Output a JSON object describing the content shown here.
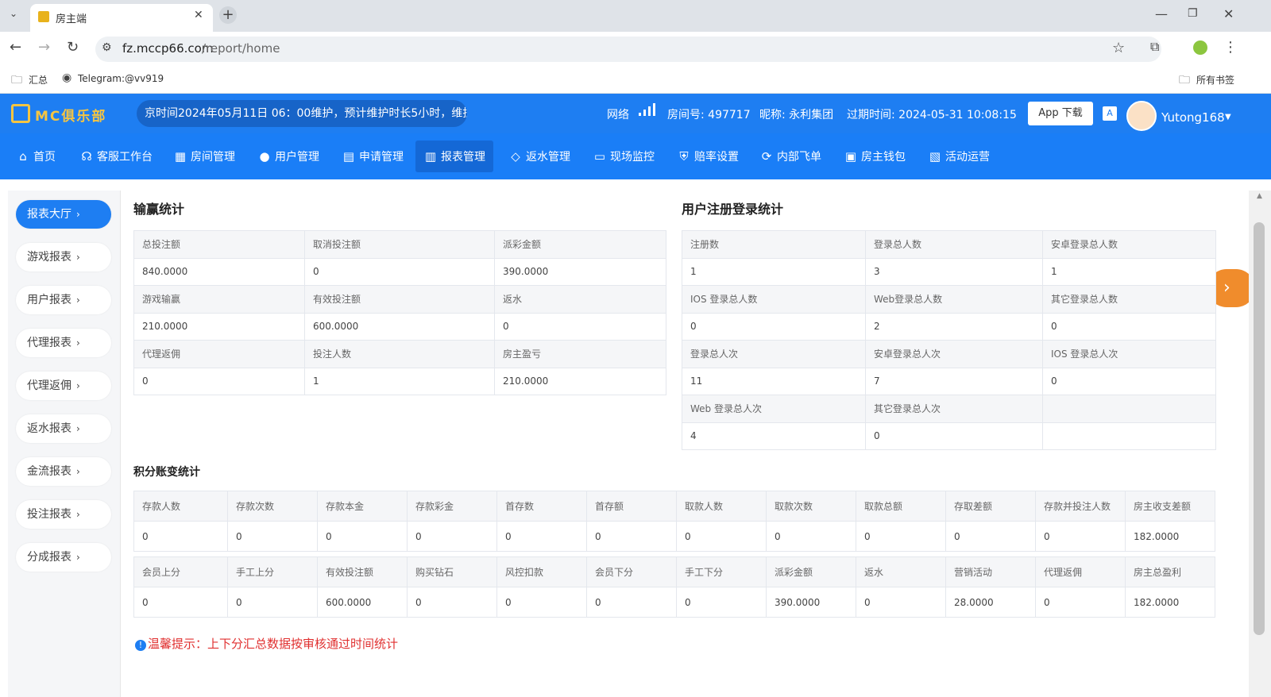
{
  "browser": {
    "tab_title": "房主端",
    "url_host": "fz.mccp66.com",
    "url_path": "/report/home",
    "bookmarks": [
      "汇总",
      "Telegram:@vv919"
    ],
    "all_bookmarks": "所有书签"
  },
  "header": {
    "logo": "MC俱乐部",
    "marquee": "京时间2024年05月11日 06：00维护，预计维护时长5小时，维护",
    "network_label": "网络",
    "room_label": "房间号: 497717",
    "nickname": "昵称: 永利集团",
    "expire": "过期时间: 2024-05-31 10:08:15",
    "app_download": "App 下载",
    "username": "Yutong168"
  },
  "nav": [
    "首页",
    "客服工作台",
    "房间管理",
    "用户管理",
    "申请管理",
    "报表管理",
    "返水管理",
    "现场监控",
    "赔率设置",
    "内部飞单",
    "房主钱包",
    "活动运营"
  ],
  "sidebar": [
    "报表大厅",
    "游戏报表",
    "用户报表",
    "代理报表",
    "代理返佣",
    "返水报表",
    "金流报表",
    "投注报表",
    "分成报表"
  ],
  "winloss": {
    "title": "输赢统计",
    "rows": [
      [
        "总投注额",
        "取消投注额",
        "派彩金额"
      ],
      [
        "840.0000",
        "0",
        "390.0000"
      ],
      [
        "游戏输赢",
        "有效投注额",
        "返水"
      ],
      [
        "210.0000",
        "600.0000",
        "0"
      ],
      [
        "代理返佣",
        "投注人数",
        "房主盈亏"
      ],
      [
        "0",
        "1",
        "210.0000"
      ]
    ]
  },
  "register": {
    "title": "用户注册登录统计",
    "rows": [
      [
        "注册数",
        "登录总人数",
        "安卓登录总人数"
      ],
      [
        "1",
        "3",
        "1"
      ],
      [
        "IOS 登录总人数",
        "Web登录总人数",
        "其它登录总人数"
      ],
      [
        "0",
        "2",
        "0"
      ],
      [
        "登录总人次",
        "安卓登录总人次",
        "IOS 登录总人次"
      ],
      [
        "11",
        "7",
        "0"
      ],
      [
        "Web 登录总人次",
        "其它登录总人次",
        ""
      ],
      [
        "4",
        "0",
        ""
      ]
    ]
  },
  "points": {
    "title": "积分账变统计",
    "rows1": [
      [
        "存款人数",
        "存款次数",
        "存款本金",
        "存款彩金",
        "首存数",
        "首存额",
        "取款人数",
        "取款次数",
        "取款总额",
        "存取差额",
        "存款并投注人数",
        "房主收支差额"
      ],
      [
        "0",
        "0",
        "0",
        "0",
        "0",
        "0",
        "0",
        "0",
        "0",
        "0",
        "0",
        "182.0000"
      ]
    ],
    "rows2": [
      [
        "会员上分",
        "手工上分",
        "有效投注额",
        "购买钻石",
        "风控扣款",
        "会员下分",
        "手工下分",
        "派彩金额",
        "返水",
        "营销活动",
        "代理返佣",
        "房主总盈利"
      ],
      [
        "0",
        "0",
        "600.0000",
        "0",
        "0",
        "0",
        "0",
        "390.0000",
        "0",
        "28.0000",
        "0",
        "182.0000"
      ]
    ]
  },
  "tip": "温馨提示：上下分汇总数据按审核通过时间统计",
  "colors": {
    "brand": "#1e7ef2",
    "nav": "#1a7ef7",
    "accent_orange": "#f08c2c",
    "tip_red": "#e03030"
  }
}
